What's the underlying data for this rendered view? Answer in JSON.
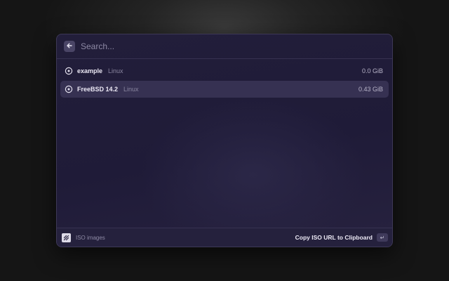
{
  "search": {
    "placeholder": "Search..."
  },
  "icons": {
    "back": "arrow-left-icon",
    "item": "disc-icon",
    "extension": "extension-logo-icon",
    "enter": "return-key-icon"
  },
  "items": [
    {
      "title": "example",
      "subtitle": "Linux",
      "size": "0.0 GiB",
      "selected": false
    },
    {
      "title": "FreeBSD 14.2",
      "subtitle": "Linux",
      "size": "0.43 GiB",
      "selected": true
    }
  ],
  "action_bar": {
    "extension_name": "ISO images",
    "primary_action": "Copy ISO URL to Clipboard",
    "enter_glyph": "↵"
  },
  "colors": {
    "window_bg": "#1f1b38",
    "selected_row": "#363152",
    "text_primary": "#ece9f5",
    "text_secondary": "#8a86a0"
  }
}
